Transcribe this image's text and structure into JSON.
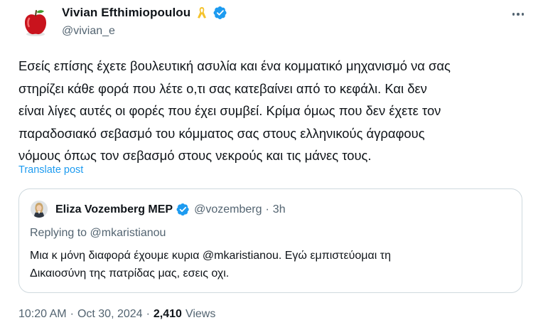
{
  "post": {
    "author": {
      "display_name": "Vivian Efthimiopoulou",
      "handle": "@vivian_e",
      "avatar_icon": "red-apple-icon",
      "badge_icon": "yellow-ribbon-icon",
      "verified_icon": "verified-badge-icon",
      "verified_color": "#1d9bf0"
    },
    "more_icon": "more-options-icon",
    "text_lines": [
      "Εσείς επίσης έχετε βουλευτική ασυλία και ένα κομματικό μηχανισμό να σας",
      "στηρίζει κάθε φορά που λέτε ο,τι σας κατεβαίνει από το κεφάλι. Και δεν",
      "είναι λίγες αυτές οι φορές που έχει συμβεί. Κρίμα όμως που δεν έχετε τον",
      "παραδοσιακό σεβασμό του κόμματος σας στους ελληνικούς άγραφους",
      "νόμους όπως τον σεβασμό στους νεκρούς και τις μάνες τους."
    ],
    "translate_label": "Translate post",
    "link_color": "#1d9bf0"
  },
  "quote": {
    "display_name": "Eliza Vozemberg MEP",
    "handle": "@vozemberg",
    "separator": "·",
    "time": "3h",
    "replying_to": "Replying to @mkaristianou",
    "text_lines": [
      "Μια κ μόνη διαφορά έχουμε κυρια @mkaristianou. Εγώ εμπιστεύομαι τη",
      "Δικαιοσύνη της πατρίδας μας, εσεις οχι."
    ]
  },
  "meta": {
    "time": "10:20 AM",
    "separator1": "·",
    "date": "Oct 30, 2024",
    "separator2": "·",
    "views_count": "2,410",
    "views_label": "Views"
  }
}
